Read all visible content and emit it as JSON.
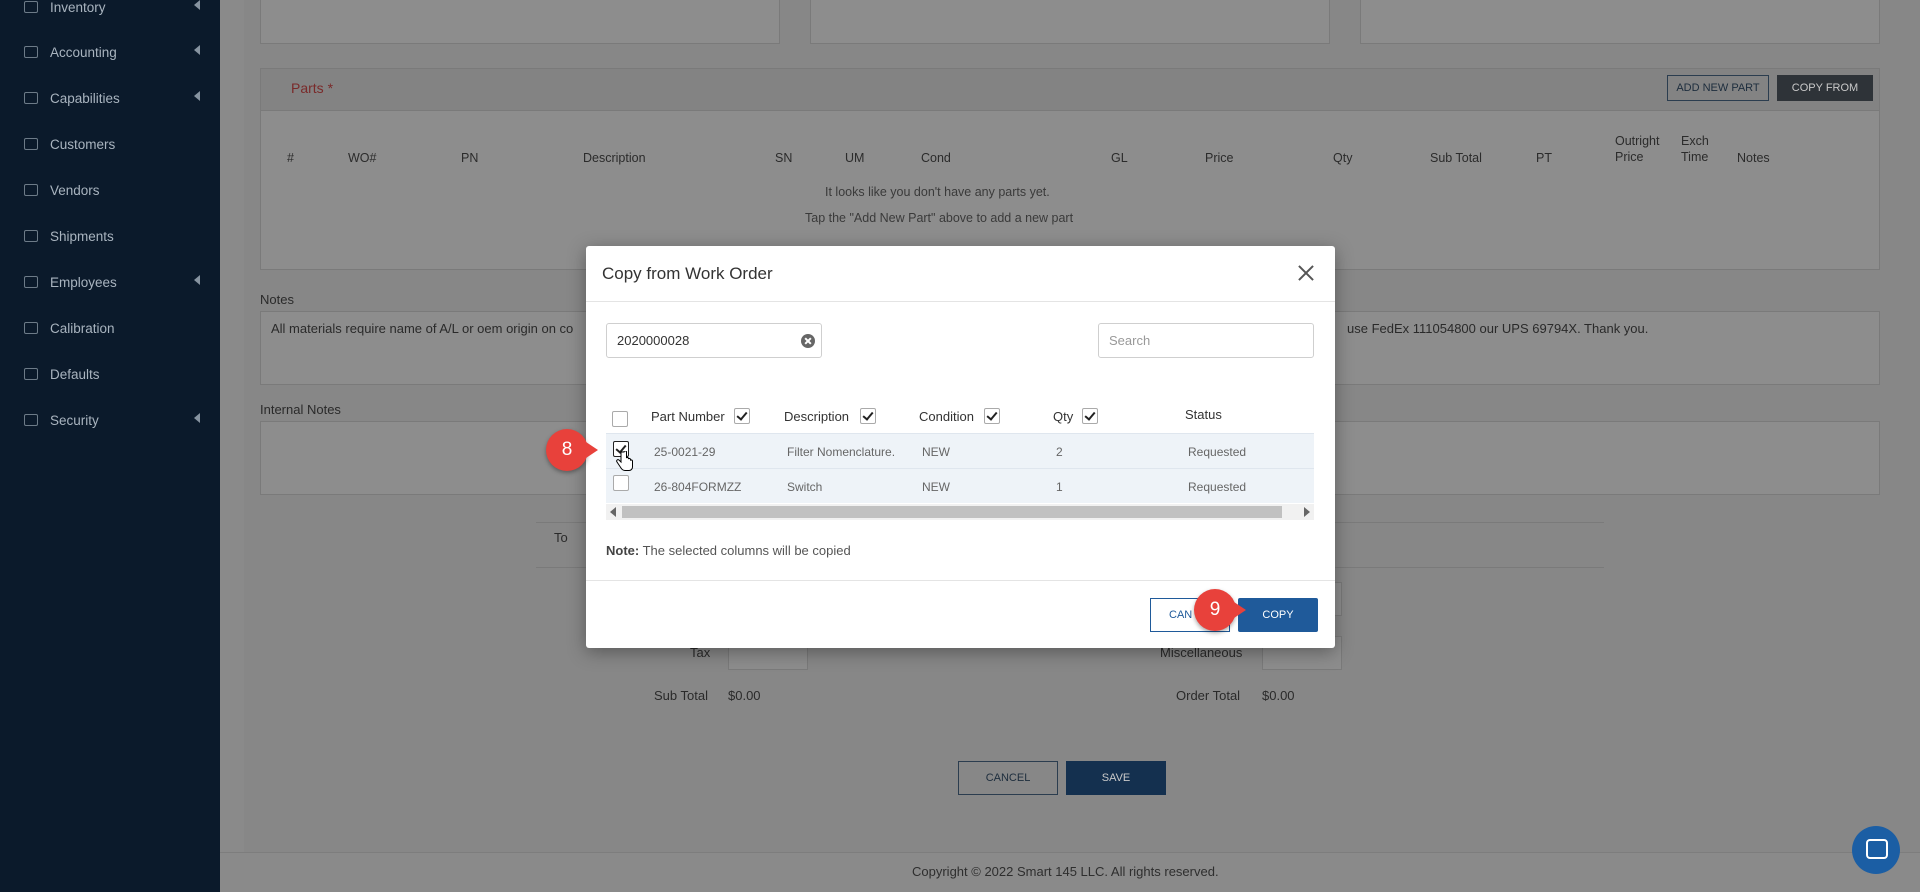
{
  "sidebar": {
    "items": [
      {
        "label": "Inventory",
        "chevron": true
      },
      {
        "label": "Accounting",
        "chevron": true
      },
      {
        "label": "Capabilities",
        "chevron": true
      },
      {
        "label": "Customers",
        "chevron": false
      },
      {
        "label": "Vendors",
        "chevron": false
      },
      {
        "label": "Shipments",
        "chevron": false
      },
      {
        "label": "Employees",
        "chevron": true
      },
      {
        "label": "Calibration",
        "chevron": false
      },
      {
        "label": "Defaults",
        "chevron": false
      },
      {
        "label": "Security",
        "chevron": true
      }
    ]
  },
  "parts": {
    "title": "Parts *",
    "add_new_part": "ADD NEW PART",
    "copy_from": "COPY FROM",
    "columns": [
      "#",
      "WO#",
      "PN",
      "Description",
      "SN",
      "UM",
      "Cond",
      "GL",
      "Price",
      "Qty",
      "Sub Total",
      "PT",
      "Outright Price",
      "Exch Time",
      "Notes"
    ],
    "empty_line1": "It looks like you don't have any parts yet.",
    "empty_line2": "Tap the \"Add New Part\" above to add a new part"
  },
  "notes": {
    "label": "Notes",
    "text_left": "All materials require name of A/L or oem origin on co",
    "text_right": "use FedEx 111054800 our UPS 69794X. Thank you."
  },
  "internal_notes": {
    "label": "Internal Notes"
  },
  "totals": {
    "heading_fragment": "To",
    "tax_label": "Tax",
    "misc_label": "Miscellaneous",
    "sub_total_label": "Sub Total",
    "sub_total_value": "$0.00",
    "order_total_label": "Order Total",
    "order_total_value": "$0.00"
  },
  "form_buttons": {
    "cancel": "CANCEL",
    "save": "SAVE"
  },
  "footer": {
    "copyright": "Copyright © 2022 Smart 145 LLC. All rights reserved."
  },
  "modal": {
    "title": "Copy from Work Order",
    "work_order_value": "2020000028",
    "search_placeholder": "Search",
    "columns": [
      {
        "label": "Part Number",
        "checked": true
      },
      {
        "label": "Description",
        "checked": true
      },
      {
        "label": "Condition",
        "checked": true
      },
      {
        "label": "Qty",
        "checked": true
      },
      {
        "label": "Status",
        "checked": false
      }
    ],
    "rows": [
      {
        "selected": true,
        "part_number": "25-0021-29",
        "description": "Filter Nomenclature.",
        "condition": "NEW",
        "qty": "2",
        "status": "Requested"
      },
      {
        "selected": false,
        "part_number": "26-804FORMZZ",
        "description": "Switch",
        "condition": "NEW",
        "qty": "1",
        "status": "Requested"
      }
    ],
    "note_label": "Note:",
    "note_text": " The selected columns will be copied",
    "cancel_label": "CANCEL",
    "cancel_visible": "CAN",
    "copy_label": "COPY"
  },
  "step_badges": {
    "step8": "8",
    "step9": "9"
  },
  "colors": {
    "primary": "#1f5a9a",
    "badge": "#e8413b",
    "sidebar": "#0b1a2b"
  }
}
